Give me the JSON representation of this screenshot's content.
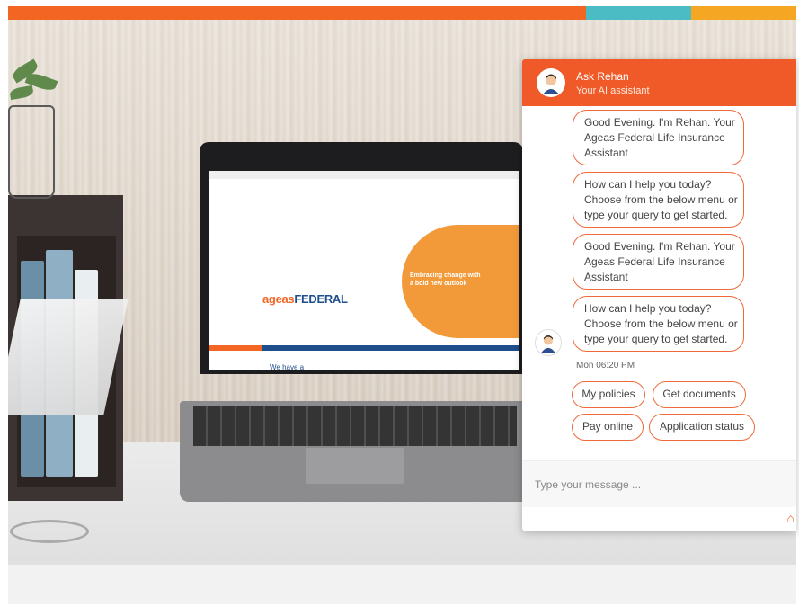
{
  "colors": {
    "stripe": [
      "#f26522",
      "#4bbcc4",
      "#f5a623"
    ],
    "accent": "#ef5a28",
    "bubble_border": "#ef6a3a"
  },
  "chat": {
    "title": "Ask Rehan",
    "subtitle": "Your AI assistant",
    "avatar_icon": "agent-avatar-icon",
    "messages": [
      "Good Evening. I'm Rehan. Your Ageas Federal Life Insurance Assistant",
      "How can I help you today? Choose from the below menu or type your query to get started.",
      "Good Evening. I'm Rehan. Your Ageas Federal Life Insurance Assistant",
      "How can I help you today? Choose from the below menu or type your query to get started."
    ],
    "timestamp": "Mon 06:20 PM",
    "quick_replies": [
      "My policies",
      "Get documents",
      "Pay online",
      "Application status"
    ],
    "input_placeholder": "Type your message ...",
    "home_icon": "home-icon"
  },
  "laptop_screen": {
    "logo_part1": "ageas",
    "logo_part2": "FEDERAL",
    "hero_text": "Embracing change with a bold new outlook",
    "we_have": "We have a"
  }
}
